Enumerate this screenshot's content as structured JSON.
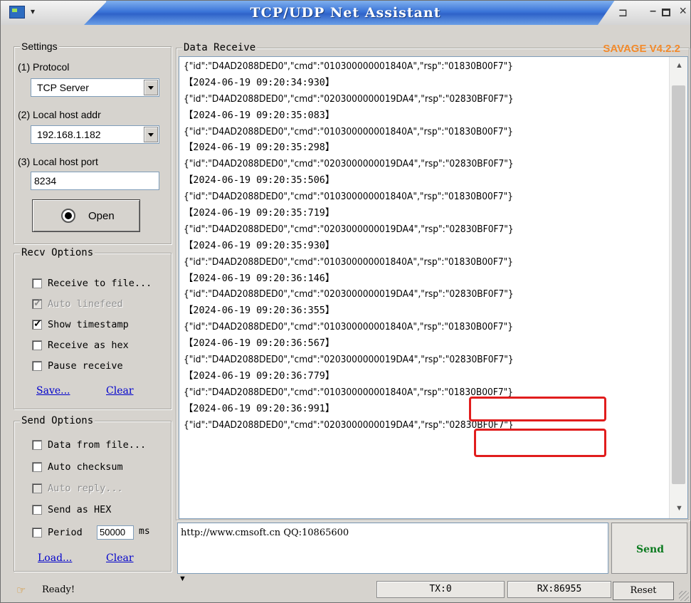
{
  "window": {
    "title": "TCP/UDP Net Assistant",
    "brand": "SAVAGE V4.2.2"
  },
  "settings": {
    "legend": "Settings",
    "protocol_label": "(1) Protocol",
    "protocol_value": "TCP Server",
    "host_label": "(2) Local host addr",
    "host_value": "192.168.1.182",
    "port_label": "(3) Local host port",
    "port_value": "8234",
    "open_label": "Open"
  },
  "recv_options": {
    "legend": "Recv Options",
    "items": [
      {
        "label": "Receive to file...",
        "checked": false,
        "disabled": false
      },
      {
        "label": "Auto linefeed",
        "checked": true,
        "disabled": true
      },
      {
        "label": "Show timestamp",
        "checked": true,
        "disabled": false
      },
      {
        "label": "Receive as hex",
        "checked": false,
        "disabled": false
      },
      {
        "label": "Pause receive",
        "checked": false,
        "disabled": false
      }
    ],
    "save_link": "Save...",
    "clear_link": "Clear"
  },
  "send_options": {
    "legend": "Send Options",
    "items": [
      {
        "label": "Data from file...",
        "checked": false,
        "disabled": false
      },
      {
        "label": "Auto checksum",
        "checked": false,
        "disabled": false
      },
      {
        "label": "Auto reply...",
        "checked": false,
        "disabled": true
      },
      {
        "label": "Send as HEX",
        "checked": false,
        "disabled": false
      }
    ],
    "period_label": "Period",
    "period_value": "50000",
    "period_unit": "ms",
    "load_link": "Load...",
    "clear_link": "Clear"
  },
  "data_receive": {
    "legend": "Data Receive",
    "lines": [
      "{\"id\":\"D4AD2088DED0\",\"cmd\":\"010300000001840A\",\"rsp\":\"01830B00F7\"}",
      "【2024-06-19 09:20:34:930】",
      "{\"id\":\"D4AD2088DED0\",\"cmd\":\"0203000000019DA4\",\"rsp\":\"02830BF0F7\"}",
      "【2024-06-19 09:20:35:083】",
      "{\"id\":\"D4AD2088DED0\",\"cmd\":\"010300000001840A\",\"rsp\":\"01830B00F7\"}",
      "【2024-06-19 09:20:35:298】",
      "{\"id\":\"D4AD2088DED0\",\"cmd\":\"0203000000019DA4\",\"rsp\":\"02830BF0F7\"}",
      "【2024-06-19 09:20:35:506】",
      "{\"id\":\"D4AD2088DED0\",\"cmd\":\"010300000001840A\",\"rsp\":\"01830B00F7\"}",
      "【2024-06-19 09:20:35:719】",
      "{\"id\":\"D4AD2088DED0\",\"cmd\":\"0203000000019DA4\",\"rsp\":\"02830BF0F7\"}",
      "【2024-06-19 09:20:35:930】",
      "{\"id\":\"D4AD2088DED0\",\"cmd\":\"010300000001840A\",\"rsp\":\"01830B00F7\"}",
      "【2024-06-19 09:20:36:146】",
      "{\"id\":\"D4AD2088DED0\",\"cmd\":\"0203000000019DA4\",\"rsp\":\"02830BF0F7\"}",
      "【2024-06-19 09:20:36:355】",
      "{\"id\":\"D4AD2088DED0\",\"cmd\":\"010300000001840A\",\"rsp\":\"01830B00F7\"}",
      "【2024-06-19 09:20:36:567】",
      "{\"id\":\"D4AD2088DED0\",\"cmd\":\"0203000000019DA4\",\"rsp\":\"02830BF0F7\"}",
      "【2024-06-19 09:20:36:779】",
      "{\"id\":\"D4AD2088DED0\",\"cmd\":\"010300000001840A\",\"rsp\":\"01830B00F7\"}",
      "【2024-06-19 09:20:36:991】",
      "{\"id\":\"D4AD2088DED0\",\"cmd\":\"0203000000019DA4\",\"rsp\":\"02830BF0F7\"}"
    ]
  },
  "send": {
    "text": "http://www.cmsoft.cn QQ:10865600",
    "button": "Send"
  },
  "status": {
    "text": "Ready!",
    "tx": "TX:0",
    "rx": "RX:86955",
    "reset": "Reset"
  },
  "colors": {
    "brand": "#f28a2b",
    "send_label": "#0a7a1e",
    "highlight": "#e11d1d",
    "link": "#0000cc"
  }
}
